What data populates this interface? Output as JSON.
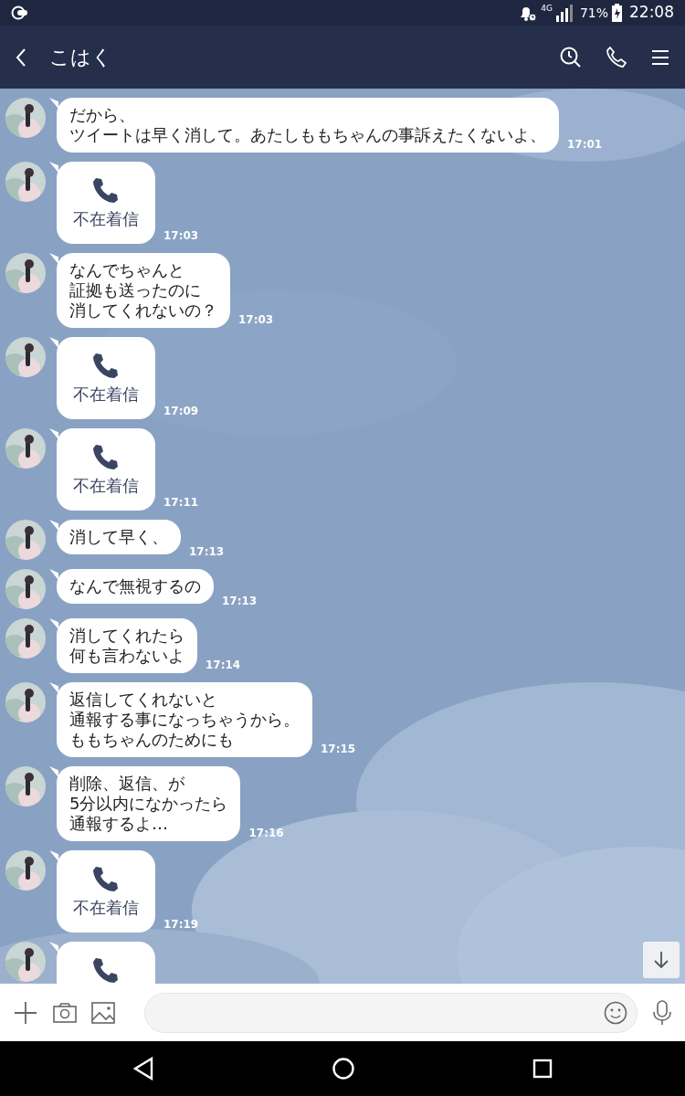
{
  "status_bar": {
    "network": "4G",
    "battery": "71%",
    "time": "22:08"
  },
  "header": {
    "title": "こはく"
  },
  "messages": [
    {
      "kind": "text",
      "lines": [
        "だから、",
        "ツイートは早く消して。あたしももちゃんの事訴えたくないよ、"
      ],
      "time": "17:01"
    },
    {
      "kind": "call",
      "label": "不在着信",
      "time": "17:03"
    },
    {
      "kind": "text",
      "lines": [
        "なんでちゃんと",
        "証拠も送ったのに",
        "消してくれないの？"
      ],
      "time": "17:03"
    },
    {
      "kind": "call",
      "label": "不在着信",
      "time": "17:09"
    },
    {
      "kind": "call",
      "label": "不在着信",
      "time": "17:11"
    },
    {
      "kind": "text",
      "lines": [
        "消して早く、"
      ],
      "time": "17:13"
    },
    {
      "kind": "text",
      "lines": [
        "なんで無視するの"
      ],
      "time": "17:13"
    },
    {
      "kind": "text",
      "lines": [
        "消してくれたら",
        "何も言わないよ"
      ],
      "time": "17:14"
    },
    {
      "kind": "text",
      "lines": [
        "返信してくれないと",
        "通報する事になっちゃうから。",
        "ももちゃんのためにも"
      ],
      "time": "17:15"
    },
    {
      "kind": "text",
      "lines": [
        "削除、返信、が",
        "5分以内になかったら",
        "通報するよ…"
      ],
      "time": "17:16"
    },
    {
      "kind": "call",
      "label": "不在着信",
      "time": "17:19"
    },
    {
      "kind": "call"
    }
  ]
}
